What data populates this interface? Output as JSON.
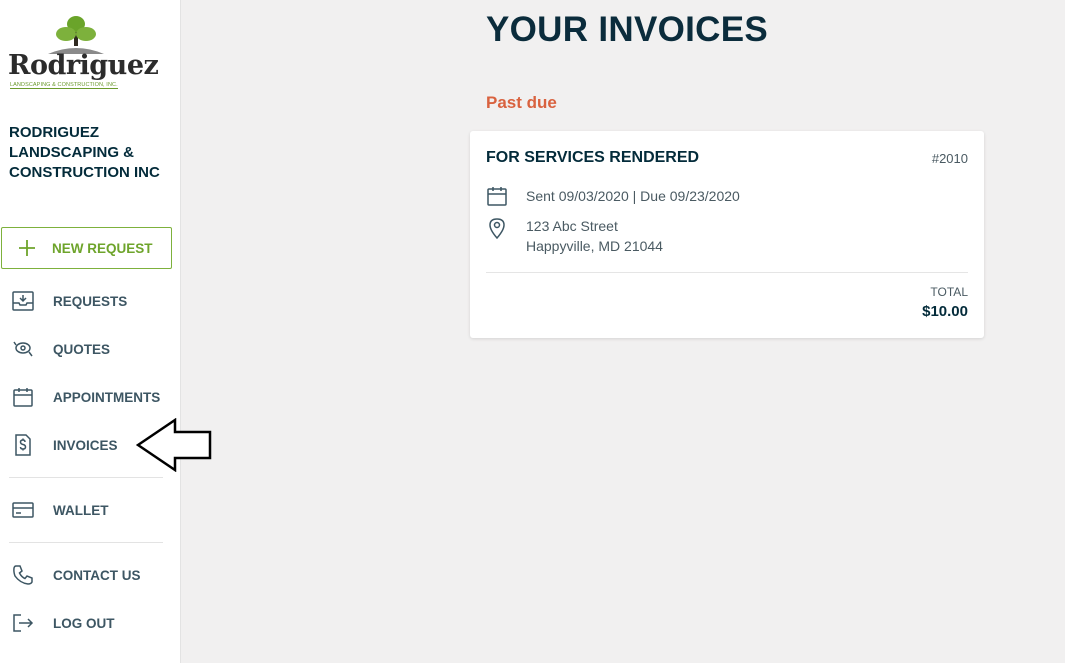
{
  "brand": {
    "logo_word": "Rodriguez",
    "logo_tagline": "LANDSCAPING & CONSTRUCTION, INC.",
    "company_name": "RODRIGUEZ LANDSCAPING & CONSTRUCTION INC",
    "accent_color": "#7db13c"
  },
  "sidebar": {
    "new_request_label": "NEW REQUEST",
    "items": [
      {
        "label": "REQUESTS",
        "icon": "inbox-download-icon"
      },
      {
        "label": "QUOTES",
        "icon": "quote-lasso-icon"
      },
      {
        "label": "APPOINTMENTS",
        "icon": "calendar-icon"
      },
      {
        "label": "INVOICES",
        "icon": "invoice-dollar-icon"
      },
      {
        "label": "WALLET",
        "icon": "credit-card-icon"
      },
      {
        "label": "CONTACT US",
        "icon": "phone-icon"
      },
      {
        "label": "LOG OUT",
        "icon": "logout-icon"
      }
    ]
  },
  "main": {
    "title": "YOUR INVOICES",
    "section_label": "Past due",
    "invoice": {
      "title": "FOR SERVICES RENDERED",
      "number": "#2010",
      "dates": "Sent 09/03/2020 | Due 09/23/2020",
      "address_line1": "123 Abc Street",
      "address_line2": "Happyville, MD 21044",
      "total_label": "TOTAL",
      "total_value": "$10.00"
    }
  }
}
